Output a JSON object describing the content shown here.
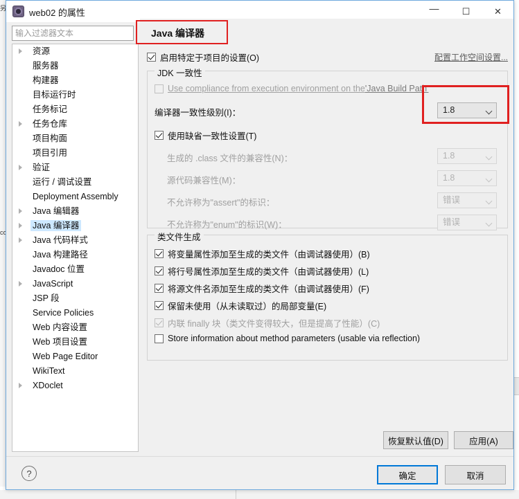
{
  "window": {
    "title": "web02 的属性",
    "icon": "properties-icon",
    "minimize": "—",
    "maximize": "☐",
    "close": "✕"
  },
  "background": {
    "left_label_top": "另",
    "left_label_mid": "co"
  },
  "toolbar": {
    "back_icon": "back-arrow-icon",
    "back_dropdown_icon": "chevron-down-icon",
    "forward_icon": "forward-arrow-icon",
    "forward_dropdown_icon": "chevron-down-icon",
    "menu_dropdown_icon": "chevron-down-icon"
  },
  "filter": {
    "placeholder": "输入过滤器文本",
    "value": ""
  },
  "tree": {
    "items": [
      {
        "label": "资源",
        "expandable": true,
        "selected": false
      },
      {
        "label": "服务器",
        "expandable": false,
        "selected": false
      },
      {
        "label": "构建器",
        "expandable": false,
        "selected": false
      },
      {
        "label": "目标运行时",
        "expandable": false,
        "selected": false
      },
      {
        "label": "任务标记",
        "expandable": false,
        "selected": false
      },
      {
        "label": "任务仓库",
        "expandable": true,
        "selected": false
      },
      {
        "label": "项目构面",
        "expandable": false,
        "selected": false
      },
      {
        "label": "项目引用",
        "expandable": false,
        "selected": false
      },
      {
        "label": "验证",
        "expandable": true,
        "selected": false
      },
      {
        "label": "运行 / 调试设置",
        "expandable": false,
        "selected": false
      },
      {
        "label": "Deployment Assembly",
        "expandable": false,
        "selected": false
      },
      {
        "label": "Java 编辑器",
        "expandable": true,
        "selected": false
      },
      {
        "label": "Java 编译器",
        "expandable": true,
        "selected": true
      },
      {
        "label": "Java 代码样式",
        "expandable": true,
        "selected": false
      },
      {
        "label": "Java 构建路径",
        "expandable": false,
        "selected": false
      },
      {
        "label": "Javadoc 位置",
        "expandable": false,
        "selected": false
      },
      {
        "label": "JavaScript",
        "expandable": true,
        "selected": false
      },
      {
        "label": "JSP 段",
        "expandable": false,
        "selected": false
      },
      {
        "label": "Service Policies",
        "expandable": false,
        "selected": false
      },
      {
        "label": "Web 内容设置",
        "expandable": false,
        "selected": false
      },
      {
        "label": "Web 项目设置",
        "expandable": false,
        "selected": false
      },
      {
        "label": "Web Page Editor",
        "expandable": false,
        "selected": false
      },
      {
        "label": "WikiText",
        "expandable": false,
        "selected": false
      },
      {
        "label": "XDoclet",
        "expandable": true,
        "selected": false
      }
    ]
  },
  "page": {
    "title": "Java 编译器",
    "workspace_link": "配置工作空间设置...",
    "enable_project_specific": {
      "label": "启用特定于项目的设置(O)",
      "checked": true,
      "enabled": true
    }
  },
  "jdk_group": {
    "legend": "JDK 一致性",
    "use_compliance": {
      "label_plain": "Use compliance from execution environment on the ",
      "label_link": "'Java Build Path'",
      "checked": false,
      "enabled": false
    },
    "compliance_level": {
      "label": "编译器一致性级别(I)：",
      "value": "1.8",
      "enabled": true
    },
    "use_default_compliance": {
      "label": "使用缺省一致性设置(T)",
      "checked": true,
      "enabled": true
    },
    "rows": [
      {
        "label": "生成的 .class 文件的兼容性(N)：",
        "value": "1.8",
        "enabled": false
      },
      {
        "label": "源代码兼容性(M)：",
        "value": "1.8",
        "enabled": false
      },
      {
        "label": "不允许称为\"assert\"的标识：",
        "value": "错误",
        "enabled": false
      },
      {
        "label": "不允许称为\"enum\"的标识(W)：",
        "value": "错误",
        "enabled": false
      }
    ]
  },
  "classfile_group": {
    "legend": "类文件生成",
    "checkboxes": [
      {
        "label": "将变量属性添加至生成的类文件（由调试器使用）(B)",
        "checked": true,
        "enabled": true
      },
      {
        "label": "将行号属性添加至生成的类文件（由调试器使用）(L)",
        "checked": true,
        "enabled": true
      },
      {
        "label": "将源文件名添加至生成的类文件（由调试器使用）(F)",
        "checked": true,
        "enabled": true
      },
      {
        "label": "保留未使用（从未读取过）的局部变量(E)",
        "checked": true,
        "enabled": true
      },
      {
        "label": "内联 finally 块（类文件变得较大，但是提高了性能）(C)",
        "checked": true,
        "enabled": false
      },
      {
        "label": "Store information about method parameters (usable via reflection)",
        "checked": false,
        "enabled": true
      }
    ]
  },
  "buttons": {
    "restore_defaults": "恢复默认值(D)",
    "apply": "应用(A)",
    "ok": "确定",
    "cancel": "取消",
    "help_icon": "help-question-icon",
    "help_glyph": "?"
  },
  "annotations": {
    "title_highlight_color": "#e02020",
    "combo_highlight_color": "#e02020"
  }
}
